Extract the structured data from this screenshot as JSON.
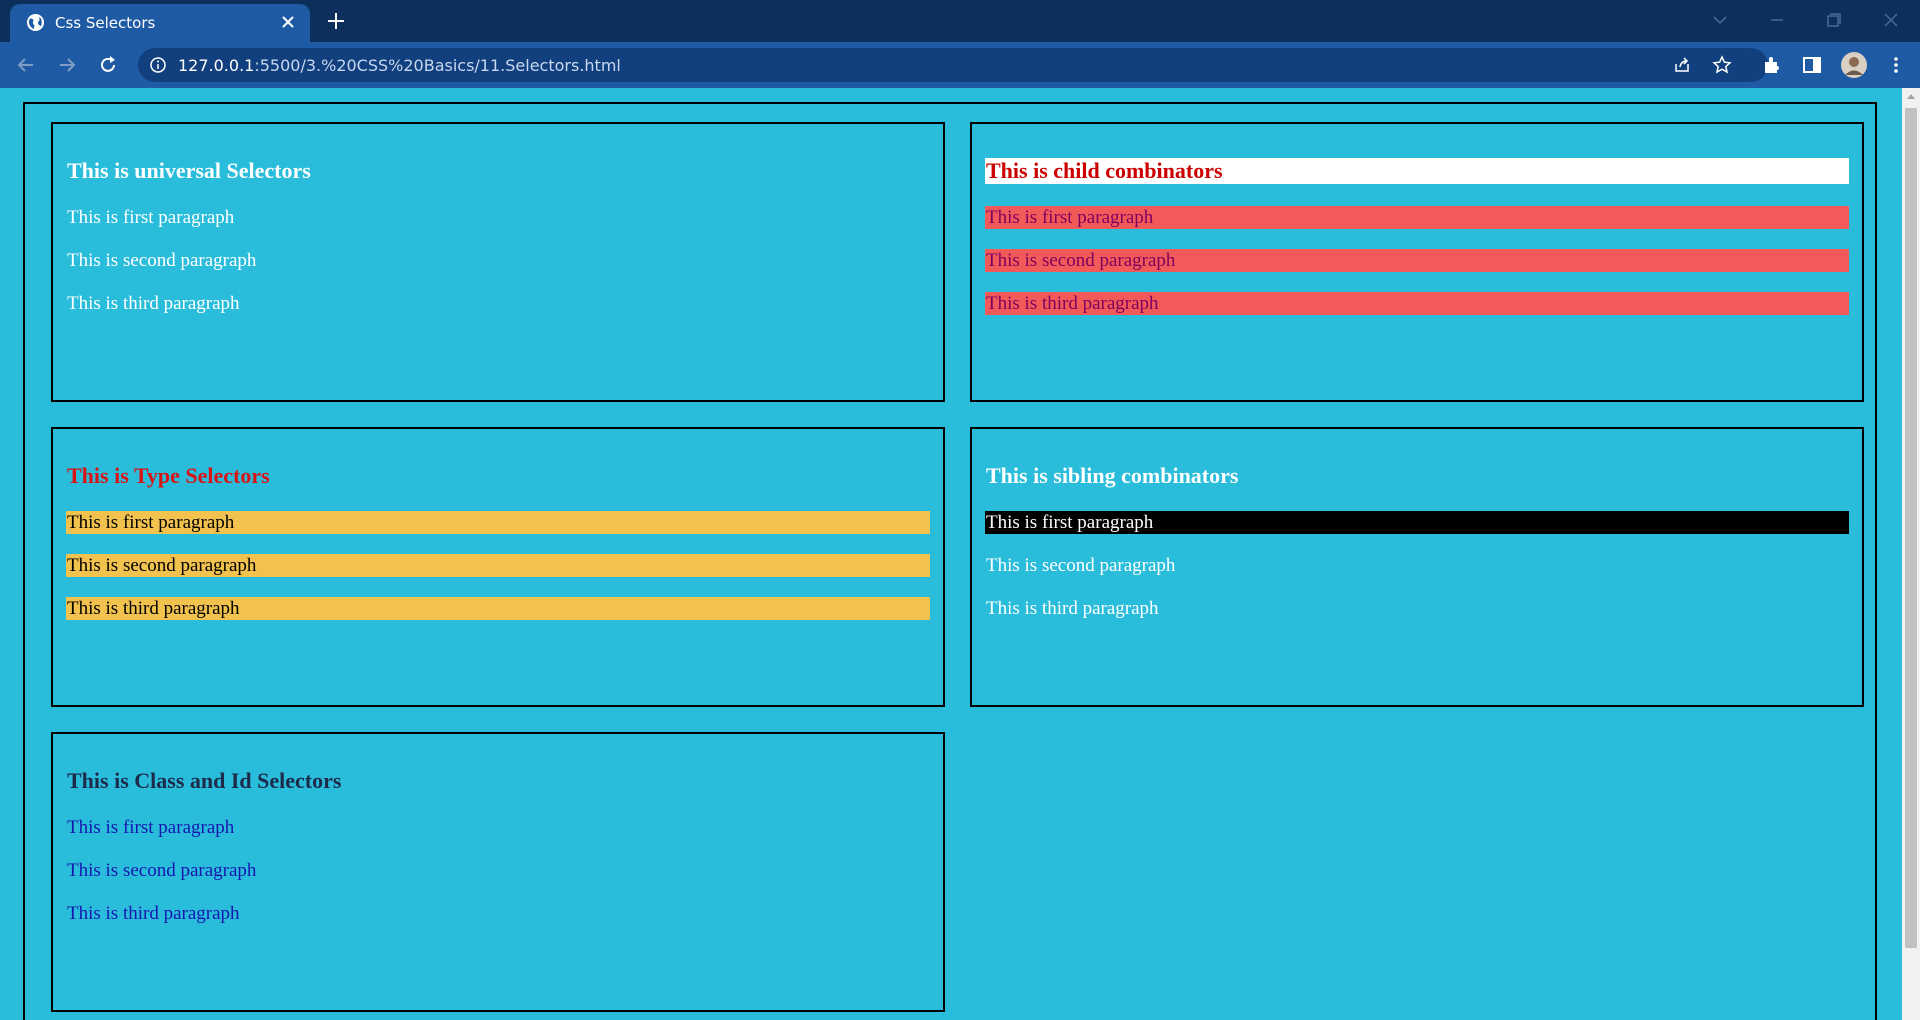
{
  "browser": {
    "tab_title": "Css Selectors",
    "url_host": "127.0.0.1",
    "url_path": ":5500/3.%20CSS%20Basics/11.Selectors.html"
  },
  "cards": {
    "universal": {
      "heading": "This is universal Selectors",
      "paragraphs": [
        "This is first paragraph",
        "This is second paragraph",
        "This is third paragraph"
      ]
    },
    "child": {
      "heading": "This is child combinators",
      "paragraphs": [
        "This is first paragraph",
        "This is second paragraph",
        "This is third paragraph"
      ]
    },
    "type": {
      "heading": "This is Type Selectors",
      "paragraphs": [
        "This is first paragraph",
        "This is second paragraph",
        "This is third paragraph"
      ]
    },
    "sibling": {
      "heading": "This is sibling combinators",
      "paragraphs": [
        "This is first paragraph",
        "This is second paragraph",
        "This is third paragraph"
      ]
    },
    "class_id": {
      "heading": "This is Class and Id Selectors",
      "paragraphs": [
        "This is first paragraph",
        "This is second paragraph",
        "This is third paragraph"
      ]
    }
  },
  "colors": {
    "page_background": "#29bddb",
    "child_heading_text": "#cc0000",
    "child_paragraph_background": "#f25a5a",
    "type_heading_text": "#d81414",
    "type_paragraph_background": "#f2c24f",
    "sibling_first_background": "#000000",
    "class_paragraph_text": "#1717b0"
  }
}
